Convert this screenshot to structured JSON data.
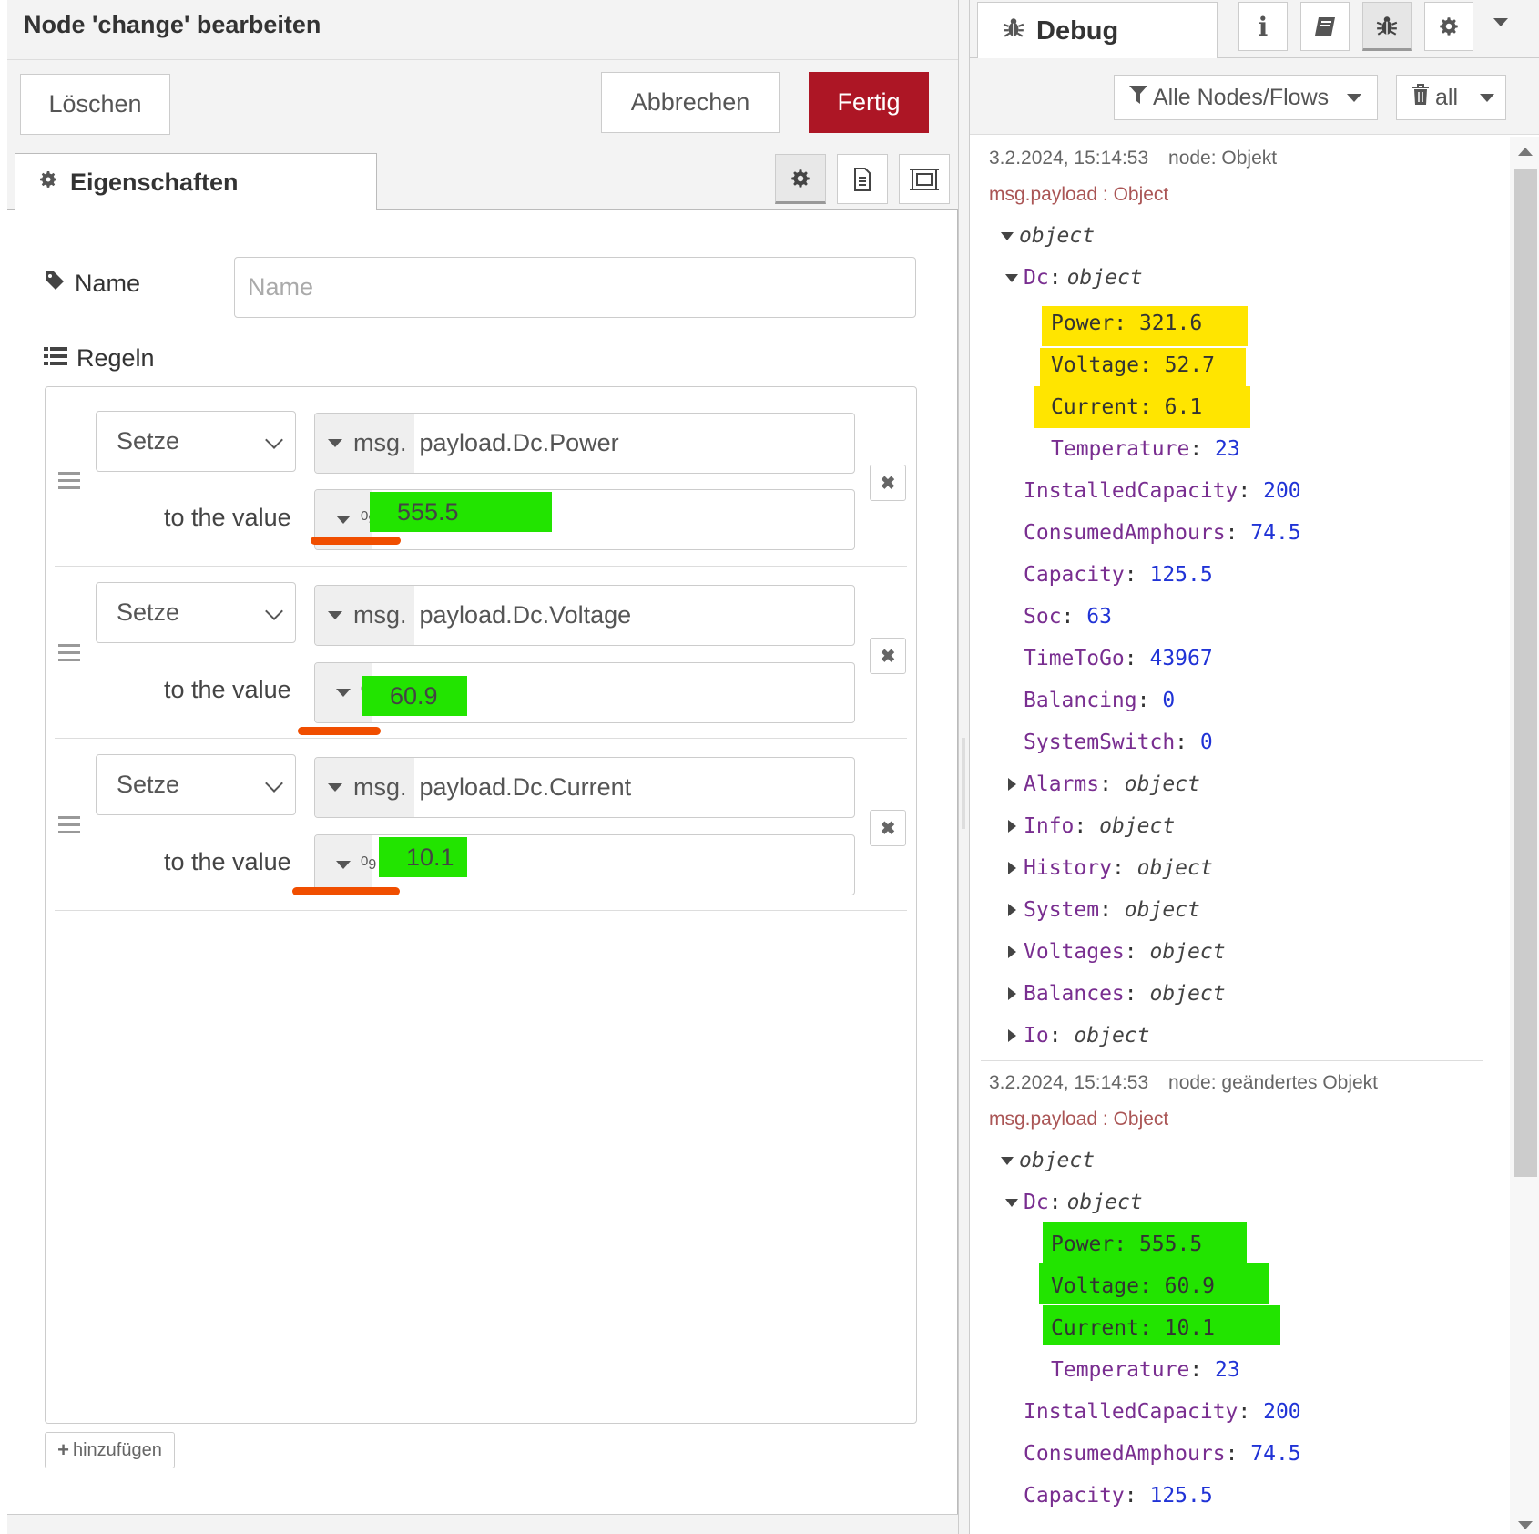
{
  "editor": {
    "title": "Node 'change' bearbeiten",
    "delete_label": "Löschen",
    "cancel_label": "Abbrechen",
    "done_label": "Fertig",
    "tab_label": "Eigenschaften",
    "name_label": "Name",
    "name_placeholder": "Name",
    "rules_label": "Regeln",
    "add_label": "hinzufügen",
    "rules": [
      {
        "action": "Setze",
        "prefix": "msg.",
        "property": "payload.Dc.Power",
        "to_label": "to the value",
        "value": "555.5"
      },
      {
        "action": "Setze",
        "prefix": "msg.",
        "property": "payload.Dc.Voltage",
        "to_label": "to the value",
        "value": "60.9"
      },
      {
        "action": "Setze",
        "prefix": "msg.",
        "property": "payload.Dc.Current",
        "to_label": "to the value",
        "value": "10.1"
      }
    ],
    "accent_color": "#ad1625",
    "highlight_color": "#22e400",
    "underline_color": "#f04e00"
  },
  "debug": {
    "tab_label": "Debug",
    "filter_label": "Alle Nodes/Flows",
    "clear_label": "all",
    "messages": [
      {
        "timestamp": "3.2.2024, 15:14:53",
        "node": "node: Objekt",
        "topic": "msg.payload : Object",
        "root": "object",
        "dc_label": "Dc",
        "dc_type": "object",
        "highlight": "#ffe500",
        "fields": [
          {
            "key": "Power",
            "value": "321.6"
          },
          {
            "key": "Voltage",
            "value": "52.7"
          },
          {
            "key": "Current",
            "value": "6.1"
          },
          {
            "key": "Temperature",
            "value": "23"
          }
        ],
        "props": [
          {
            "key": "InstalledCapacity",
            "value": "200"
          },
          {
            "key": "ConsumedAmphours",
            "value": "74.5"
          },
          {
            "key": "Capacity",
            "value": "125.5"
          },
          {
            "key": "Soc",
            "value": "63"
          },
          {
            "key": "TimeToGo",
            "value": "43967"
          },
          {
            "key": "Balancing",
            "value": "0"
          },
          {
            "key": "SystemSwitch",
            "value": "0"
          }
        ],
        "objects": [
          "Alarms",
          "Info",
          "History",
          "System",
          "Voltages",
          "Balances",
          "Io"
        ],
        "object_type": "object"
      },
      {
        "timestamp": "3.2.2024, 15:14:53",
        "node": "node: geändertes Objekt",
        "topic": "msg.payload : Object",
        "root": "object",
        "dc_label": "Dc",
        "dc_type": "object",
        "highlight": "#22e400",
        "fields": [
          {
            "key": "Power",
            "value": "555.5"
          },
          {
            "key": "Voltage",
            "value": "60.9"
          },
          {
            "key": "Current",
            "value": "10.1"
          },
          {
            "key": "Temperature",
            "value": "23"
          }
        ],
        "props": [
          {
            "key": "InstalledCapacity",
            "value": "200"
          },
          {
            "key": "ConsumedAmphours",
            "value": "74.5"
          },
          {
            "key": "Capacity",
            "value": "125.5"
          }
        ]
      }
    ]
  }
}
